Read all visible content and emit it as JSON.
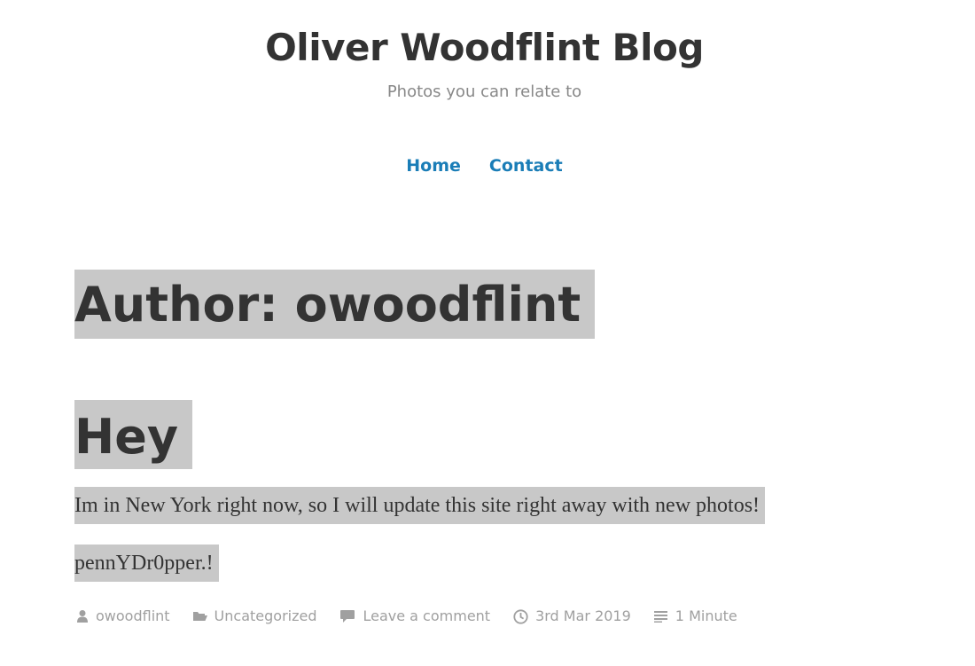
{
  "site": {
    "title": "Oliver Woodflint Blog",
    "tagline": "Photos you can relate to"
  },
  "nav": {
    "items": [
      {
        "label": "Home"
      },
      {
        "label": "Contact"
      }
    ]
  },
  "archive": {
    "title": "Author: owoodflint"
  },
  "post": {
    "title": "Hey",
    "paragraphs": [
      "Im in New York right now, so I will update this site right away with new photos!",
      "pennYDr0pper.!"
    ],
    "meta": {
      "author": "owoodflint",
      "category": "Uncategorized",
      "comments": "Leave a comment",
      "date": "3rd Mar 2019",
      "reading_time": "1 Minute"
    }
  },
  "icons": {
    "author": "person-icon",
    "category": "folder-icon",
    "comments": "comment-bubble-icon",
    "date": "clock-icon",
    "reading_time": "text-lines-icon"
  },
  "colors": {
    "link": "#1a7db7",
    "text": "#333333",
    "meta": "#a0a0a0",
    "highlight": "#c8c8c8"
  }
}
